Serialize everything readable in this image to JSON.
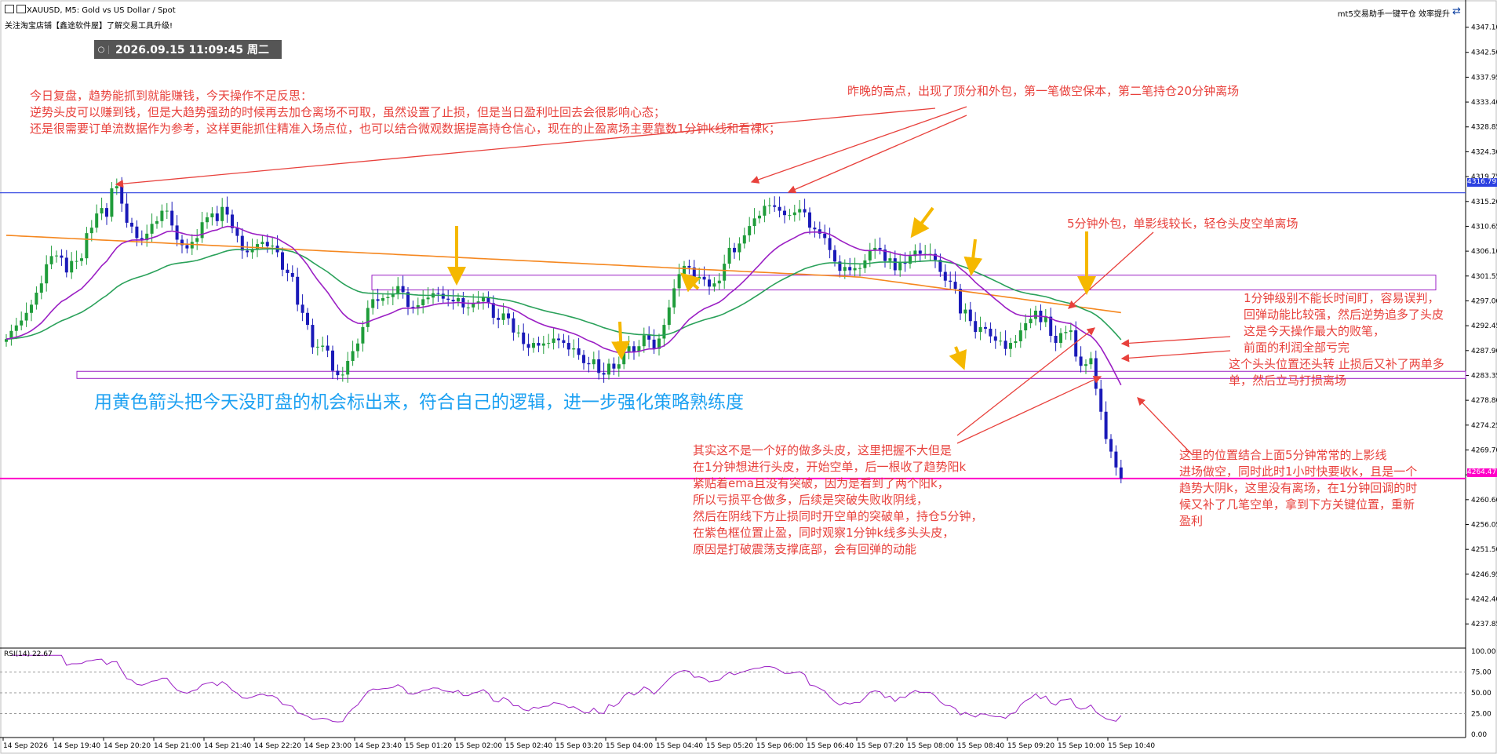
{
  "header": {
    "symbol_line": "XAUUSD, M5:  Gold vs US Dollar / Spot",
    "subtitle_line": "关注淘宝店铺【鑫途软件屋】了解交易工具升级!",
    "corner_text": "mt5交易助手一键平仓 效率提升"
  },
  "datetime": {
    "text": "2026.09.15 11:09:45 周二"
  },
  "annotations": {
    "review": [
      "今日复盘，趋势能抓到就能赚钱，今天操作不足反思：",
      "逆势头皮可以赚到钱，但是大趋势强劲的时候再去加仓离场不可取，虽然设置了止损，但是当日盈利吐回去会很影响心态；",
      "还是很需要订单流数据作为参考，这样更能抓住精准入场点位，也可以结合微观数据提高持仓信心，现在的止盈离场主要靠数1分钟k线和看裸k；"
    ],
    "yesterday_high": "昨晚的高点，出现了顶分和外包，第一笔做空保本，第二笔持仓20分钟离场",
    "outside_bar": "5分钟外包，单影线较长，轻仓头皮空单离场",
    "one_min": [
      "1分钟级别不能长时间盯，容易误判，",
      "回弹动能比较强，然后逆势追多了头皮",
      "这是今天操作最大的败笔，",
      "前面的利润全部亏完",
      "这个头头位置还头转 止损后又补了两单多",
      "单，然后立马打损离场"
    ],
    "yellow_arrows": "用黄色箭头把今天没盯盘的机会标出来，符合自己的逻辑，进一步强化策略熟练度",
    "not_good_long": [
      "其实这不是一个好的做多头皮，这里把握不大但是",
      "在1分钟想进行头皮，开始空单，后一根收了趋势阳k",
      "紧贴着ema且没有突破，因为是看到了两个阳k，",
      "所以亏损平仓做多，后续是突破失败收阴线，",
      "然后在阴线下方止损同时开空单的突破单，持仓5分钟，",
      "在紫色框位置止盈，同时观察1分钟k线多头头皮，",
      "原因是打破震荡支撑底部，会有回弹的动能"
    ],
    "position_5m": [
      "这里的位置结合上面5分钟常常的上影线",
      "进场做空，同时此时1小时快要收k，且是一个",
      "趋势大阴k，这里没有离场，在1分钟回调的时",
      "候又补了几笔空单，拿到下方关键位置，重新",
      "盈利"
    ]
  },
  "colors": {
    "up_candle": "#1f9c3a",
    "down_candle": "#1a1ab8",
    "ema_purple": "#9b1fc4",
    "ema_green": "#2aa15a",
    "ema_orange": "#f5871f",
    "resistance_line": "#2b40e0",
    "support_line": "#ff00c8",
    "annotation_red": "#e8413c",
    "yellow_arrow": "#f5b800",
    "rsi_line": "#9b1fc4"
  },
  "chart_data": [
    {
      "type": "candlestick",
      "symbol": "XAUUSD",
      "timeframe": "M5",
      "y_ticks": [
        "4347.10",
        "4342.50",
        "4337.95",
        "4333.40",
        "4328.85",
        "4324.30",
        "4319.75",
        "4315.20",
        "4310.65",
        "4306.10",
        "4301.55",
        "4297.00",
        "4292.45",
        "4287.90",
        "4283.35",
        "4278.80",
        "4274.25",
        "4269.70",
        "4265.15",
        "4260.60",
        "4256.05",
        "4251.50",
        "4246.95",
        "4242.40",
        "4237.85"
      ],
      "ylim": [
        4234.0,
        4349.5
      ],
      "x_ticks": [
        "14 Sep 2026",
        "14 Sep 19:40",
        "14 Sep 20:20",
        "14 Sep 21:00",
        "14 Sep 21:40",
        "14 Sep 22:20",
        "14 Sep 23:00",
        "14 Sep 23:40",
        "15 Sep 01:20",
        "15 Sep 02:00",
        "15 Sep 02:40",
        "15 Sep 03:20",
        "15 Sep 04:00",
        "15 Sep 04:40",
        "15 Sep 05:20",
        "15 Sep 06:00",
        "15 Sep 06:40",
        "15 Sep 07:20",
        "15 Sep 08:00",
        "15 Sep 08:40",
        "15 Sep 09:20",
        "15 Sep 10:00",
        "15 Sep 10:40"
      ],
      "resistance_level": 4316.79,
      "support_level": 4264.47,
      "resistance_label": "4316.79",
      "support_label": "4264.47",
      "boxes": [
        {
          "name": "upper-range",
          "x_from": "14 Sep 23:40",
          "x_to": "15 Sep 10:40",
          "low": 4299.0,
          "high": 4301.7
        },
        {
          "name": "lower-range",
          "x_from": "14 Sep 19:00",
          "x_to": "15 Sep 10:40",
          "low": 4282.8,
          "high": 4284.1
        }
      ],
      "close": [
        4290.0,
        4291.5,
        4292.5,
        4293.4,
        4294.8,
        4296.3,
        4298.5,
        4300.2,
        4303.7,
        4305.2,
        4305.3,
        4304.9,
        4302.2,
        4304.3,
        4304.3,
        4304.8,
        4309.4,
        4310.4,
        4313.0,
        4314.0,
        4312.4,
        4317.6,
        4318.0,
        4314.8,
        4311.3,
        4310.6,
        4308.5,
        4308.1,
        4309.3,
        4311.1,
        4311.6,
        4313.5,
        4313.5,
        4310.8,
        4308.2,
        4307.2,
        4306.6,
        4307.8,
        4308.5,
        4311.4,
        4312.3,
        4313.0,
        4311.6,
        4314.2,
        4312.8,
        4310.3,
        4308.9,
        4306.2,
        4305.9,
        4306.5,
        4307.4,
        4307.8,
        4307.0,
        4307.1,
        4305.9,
        4302.7,
        4302.1,
        4301.4,
        4296.3,
        4294.8,
        4292.6,
        4288.5,
        4288.6,
        4288.8,
        4287.9,
        4284.2,
        4283.4,
        4283.5,
        4286.0,
        4287.8,
        4289.2,
        4292.2,
        4295.7,
        4297.3,
        4297.0,
        4297.5,
        4297.7,
        4298.2,
        4299.7,
        4298.6,
        4295.9,
        4295.6,
        4296.2,
        4297.3,
        4297.6,
        4298.4,
        4298.3,
        4297.4,
        4297.2,
        4296.9,
        4297.5,
        4295.8,
        4295.8,
        4296.6,
        4296.9,
        4297.6,
        4296.6,
        4293.9,
        4293.5,
        4294.7,
        4293.8,
        4291.2,
        4291.2,
        4289.1,
        4288.4,
        4289.3,
        4288.8,
        4289.2,
        4289.3,
        4290.1,
        4289.8,
        4289.3,
        4288.1,
        4288.3,
        4287.1,
        4285.6,
        4285.4,
        4286.3,
        4283.8,
        4283.5,
        4285.5,
        4284.6,
        4285.4,
        4287.5,
        4288.7,
        4287.7,
        4288.7,
        4290.7,
        4289.9,
        4288.2,
        4290.1,
        4292.6,
        4295.8,
        4299.3,
        4301.9,
        4303.4,
        4303.1,
        4301.0,
        4301.4,
        4300.9,
        4299.6,
        4300.2,
        4300.7,
        4303.8,
        4306.7,
        4305.9,
        4307.5,
        4309.0,
        4310.7,
        4312.1,
        4312.6,
        4314.4,
        4314.5,
        4314.2,
        4313.5,
        4312.7,
        4312.7,
        4313.2,
        4313.8,
        4313.2,
        4310.4,
        4310.1,
        4309.3,
        4308.5,
        4306.3,
        4304.2,
        4302.5,
        4303.2,
        4302.6,
        4303.0,
        4303.0,
        4304.4,
        4306.2,
        4306.7,
        4306.4,
        4304.3,
        4304.8,
        4302.6,
        4304.0,
        4303.8,
        4305.2,
        4306.2,
        4305.6,
        4305.6,
        4305.6,
        4304.5,
        4302.3,
        4300.7,
        4300.5,
        4299.2,
        4294.7,
        4295.4,
        4293.3,
        4291.3,
        4292.2,
        4291.9,
        4290.5,
        4289.7,
        4289.7,
        4288.2,
        4289.3,
        4289.6,
        4291.6,
        4292.9,
        4293.7,
        4295.2,
        4293.1,
        4294.1,
        4290.6,
        4289.3,
        4291.1,
        4291.3,
        4291.6,
        4286.8,
        4285.1,
        4285.4,
        4286.5,
        4280.9,
        4276.7,
        4271.7,
        4269.4,
        4266.5,
        4264.5
      ],
      "rsi_ticks": [
        "100.00",
        "75.00",
        "50.00",
        "25.00",
        "0.00"
      ],
      "rsi_ylim": [
        0,
        100
      ],
      "rsi_label": "RSI(14) 22.67",
      "rsi_value": 22.67
    }
  ]
}
